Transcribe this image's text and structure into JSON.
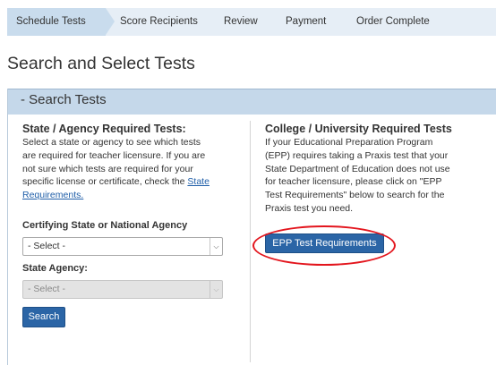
{
  "steps": [
    {
      "label": "Schedule Tests",
      "active": true
    },
    {
      "label": "Score Recipients",
      "active": false
    },
    {
      "label": "Review",
      "active": false
    },
    {
      "label": "Payment",
      "active": false
    },
    {
      "label": "Order Complete",
      "active": false
    }
  ],
  "page_title": "Search and Select Tests",
  "panel": {
    "header": "- Search Tests",
    "left": {
      "title": "State / Agency Required Tests:",
      "description_line1": "Select a state or agency to see which tests",
      "description_line2": "are required for teacher licensure. If you are",
      "description_line3": "not sure which tests are required for your",
      "description_line4": "specific license or certificate, check the ",
      "description_link_part1": "State",
      "description_link_part2": "Requirements.",
      "certifying_label": "Certifying State or National Agency",
      "certifying_value": "- Select -",
      "state_agency_label": "State Agency:",
      "state_agency_value": "- Select -",
      "search_button": "Search"
    },
    "right": {
      "title": "College / University Required Tests",
      "description_line1": "If your Educational Preparation Program",
      "description_line2": "(EPP) requires taking a Praxis test that your",
      "description_line3": "State Department of Education does not use",
      "description_line4": "for teacher licensure, please click on \"EPP",
      "description_line5": "Test Requirements\" below to search for the",
      "description_line6": "Praxis test you need.",
      "epp_button": "EPP Test Requirements"
    }
  },
  "colors": {
    "accent": "#2b65a6",
    "highlight": "#e3151d",
    "steps_bar": "#e6eef6",
    "active_step": "#c9dced",
    "panel_header": "#c5d8ea"
  },
  "icons": {
    "select_chevron": "chevron-down-icon"
  }
}
